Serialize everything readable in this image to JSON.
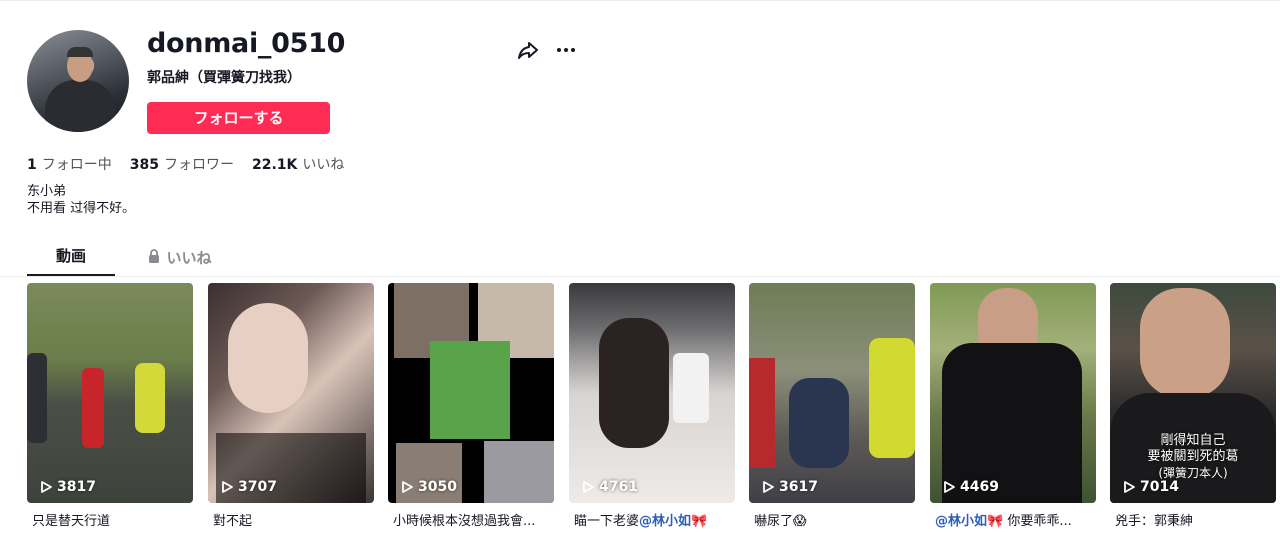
{
  "profile": {
    "username": "donmai_0510",
    "nickname": "郭品紳（買彈簧刀找我）",
    "follow_button": "フォローする"
  },
  "stats": {
    "following_count": "1",
    "following_label": "フォロー中",
    "followers_count": "385",
    "followers_label": "フォロワー",
    "likes_count": "22.1K",
    "likes_label": "いいね"
  },
  "bio": {
    "line1": "东小弟",
    "line2": "不用看 过得不好。"
  },
  "tabs": {
    "videos": "動画",
    "likes": "いいね"
  },
  "videos": [
    {
      "views": "3817",
      "caption": "只是替天行道"
    },
    {
      "views": "3707",
      "caption": "對不起"
    },
    {
      "views": "3050",
      "caption": "小時候根本沒想過我會..."
    },
    {
      "views": "4761",
      "caption_prefix": "瞄一下老婆",
      "caption_mention": "@林小如",
      "caption_suffix": "🎀"
    },
    {
      "views": "3617",
      "caption": "嚇尿了😱"
    },
    {
      "views": "4469",
      "caption_mention": "@林小如",
      "caption_suffix": "🎀 你要乖乖..."
    },
    {
      "views": "7014",
      "caption": "兇手：郭秉紳"
    }
  ],
  "video7_overlay": {
    "line1": "剛得知自己",
    "line2": "要被關到死的葛",
    "line3": "(彈簧刀本人)"
  },
  "icons": {
    "share": "share-icon",
    "more": "more-icon",
    "lock": "lock-icon",
    "play": "play-icon"
  },
  "colors": {
    "accent": "#fe2c55",
    "mention": "#2b5db9"
  }
}
